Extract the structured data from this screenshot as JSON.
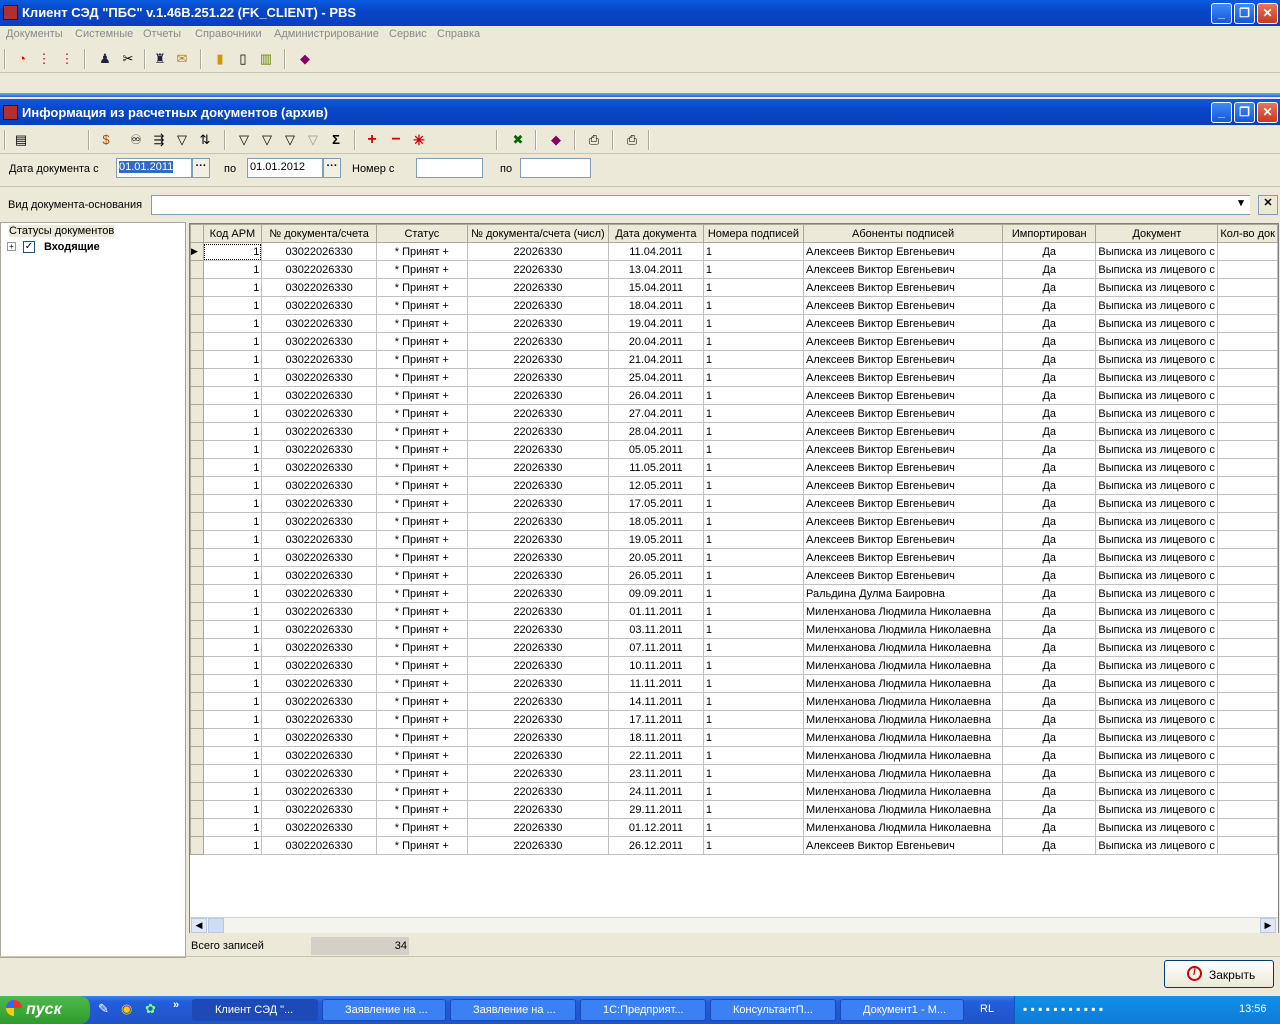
{
  "app": {
    "title": "Клиент СЭД \"ПБС\" v.1.46B.251.22 (FK_CLIENT) - PBS",
    "menu": [
      "Документы",
      "Системные",
      "Отчеты",
      "Справочники",
      "Администрирование",
      "Сервис",
      "Справка"
    ]
  },
  "child": {
    "title": "Информация из расчетных документов (архив)"
  },
  "filters": {
    "date_from_label": "Дата документа с",
    "date_from": "01.01.2011",
    "date_to_label": "по",
    "date_to": "01.01.2012",
    "num_from_label": "Номер с",
    "num_from": "",
    "num_to_label": "по",
    "num_to": "",
    "vid_label": "Вид документа-основания",
    "vid_value": ""
  },
  "left_panel": {
    "group_title": "Статусы документов",
    "tree_item": "Входящие"
  },
  "grid": {
    "columns": [
      "Код АРМ",
      "№ документа/счета",
      "Статус",
      "№ документа/счета (числ)",
      "Дата документа",
      "Номера подписей",
      "Абоненты подписей",
      "Импортирован",
      "Документ",
      "Кол-во док"
    ],
    "rows": [
      [
        "1",
        "03022026330",
        "* Принят +",
        "22026330",
        "11.04.2011",
        "1",
        "Алексеев Виктор Евгеньевич",
        "Да",
        "Выписка из лицевого с"
      ],
      [
        "1",
        "03022026330",
        "* Принят +",
        "22026330",
        "13.04.2011",
        "1",
        "Алексеев Виктор Евгеньевич",
        "Да",
        "Выписка из лицевого с"
      ],
      [
        "1",
        "03022026330",
        "* Принят +",
        "22026330",
        "15.04.2011",
        "1",
        "Алексеев Виктор Евгеньевич",
        "Да",
        "Выписка из лицевого с"
      ],
      [
        "1",
        "03022026330",
        "* Принят +",
        "22026330",
        "18.04.2011",
        "1",
        "Алексеев Виктор Евгеньевич",
        "Да",
        "Выписка из лицевого с"
      ],
      [
        "1",
        "03022026330",
        "* Принят +",
        "22026330",
        "19.04.2011",
        "1",
        "Алексеев Виктор Евгеньевич",
        "Да",
        "Выписка из лицевого с"
      ],
      [
        "1",
        "03022026330",
        "* Принят +",
        "22026330",
        "20.04.2011",
        "1",
        "Алексеев Виктор Евгеньевич",
        "Да",
        "Выписка из лицевого с"
      ],
      [
        "1",
        "03022026330",
        "* Принят +",
        "22026330",
        "21.04.2011",
        "1",
        "Алексеев Виктор Евгеньевич",
        "Да",
        "Выписка из лицевого с"
      ],
      [
        "1",
        "03022026330",
        "* Принят +",
        "22026330",
        "25.04.2011",
        "1",
        "Алексеев Виктор Евгеньевич",
        "Да",
        "Выписка из лицевого с"
      ],
      [
        "1",
        "03022026330",
        "* Принят +",
        "22026330",
        "26.04.2011",
        "1",
        "Алексеев Виктор Евгеньевич",
        "Да",
        "Выписка из лицевого с"
      ],
      [
        "1",
        "03022026330",
        "* Принят +",
        "22026330",
        "27.04.2011",
        "1",
        "Алексеев Виктор Евгеньевич",
        "Да",
        "Выписка из лицевого с"
      ],
      [
        "1",
        "03022026330",
        "* Принят +",
        "22026330",
        "28.04.2011",
        "1",
        "Алексеев Виктор Евгеньевич",
        "Да",
        "Выписка из лицевого с"
      ],
      [
        "1",
        "03022026330",
        "* Принят +",
        "22026330",
        "05.05.2011",
        "1",
        "Алексеев Виктор Евгеньевич",
        "Да",
        "Выписка из лицевого с"
      ],
      [
        "1",
        "03022026330",
        "* Принят +",
        "22026330",
        "11.05.2011",
        "1",
        "Алексеев Виктор Евгеньевич",
        "Да",
        "Выписка из лицевого с"
      ],
      [
        "1",
        "03022026330",
        "* Принят +",
        "22026330",
        "12.05.2011",
        "1",
        "Алексеев Виктор Евгеньевич",
        "Да",
        "Выписка из лицевого с"
      ],
      [
        "1",
        "03022026330",
        "* Принят +",
        "22026330",
        "17.05.2011",
        "1",
        "Алексеев Виктор Евгеньевич",
        "Да",
        "Выписка из лицевого с"
      ],
      [
        "1",
        "03022026330",
        "* Принят +",
        "22026330",
        "18.05.2011",
        "1",
        "Алексеев Виктор Евгеньевич",
        "Да",
        "Выписка из лицевого с"
      ],
      [
        "1",
        "03022026330",
        "* Принят +",
        "22026330",
        "19.05.2011",
        "1",
        "Алексеев Виктор Евгеньевич",
        "Да",
        "Выписка из лицевого с"
      ],
      [
        "1",
        "03022026330",
        "* Принят +",
        "22026330",
        "20.05.2011",
        "1",
        "Алексеев Виктор Евгеньевич",
        "Да",
        "Выписка из лицевого с"
      ],
      [
        "1",
        "03022026330",
        "* Принят +",
        "22026330",
        "26.05.2011",
        "1",
        "Алексеев Виктор Евгеньевич",
        "Да",
        "Выписка из лицевого с"
      ],
      [
        "1",
        "03022026330",
        "* Принят +",
        "22026330",
        "09.09.2011",
        "1",
        "Ральдина Дулма Баировна",
        "Да",
        "Выписка из лицевого с"
      ],
      [
        "1",
        "03022026330",
        "* Принят +",
        "22026330",
        "01.11.2011",
        "1",
        "Миленханова Людмила Николаевна",
        "Да",
        "Выписка из лицевого с"
      ],
      [
        "1",
        "03022026330",
        "* Принят +",
        "22026330",
        "03.11.2011",
        "1",
        "Миленханова Людмила Николаевна",
        "Да",
        "Выписка из лицевого с"
      ],
      [
        "1",
        "03022026330",
        "* Принят +",
        "22026330",
        "07.11.2011",
        "1",
        "Миленханова Людмила Николаевна",
        "Да",
        "Выписка из лицевого с"
      ],
      [
        "1",
        "03022026330",
        "* Принят +",
        "22026330",
        "10.11.2011",
        "1",
        "Миленханова Людмила Николаевна",
        "Да",
        "Выписка из лицевого с"
      ],
      [
        "1",
        "03022026330",
        "* Принят +",
        "22026330",
        "11.11.2011",
        "1",
        "Миленханова Людмила Николаевна",
        "Да",
        "Выписка из лицевого с"
      ],
      [
        "1",
        "03022026330",
        "* Принят +",
        "22026330",
        "14.11.2011",
        "1",
        "Миленханова Людмила Николаевна",
        "Да",
        "Выписка из лицевого с"
      ],
      [
        "1",
        "03022026330",
        "* Принят +",
        "22026330",
        "17.11.2011",
        "1",
        "Миленханова Людмила Николаевна",
        "Да",
        "Выписка из лицевого с"
      ],
      [
        "1",
        "03022026330",
        "* Принят +",
        "22026330",
        "18.11.2011",
        "1",
        "Миленханова Людмила Николаевна",
        "Да",
        "Выписка из лицевого с"
      ],
      [
        "1",
        "03022026330",
        "* Принят +",
        "22026330",
        "22.11.2011",
        "1",
        "Миленханова Людмила Николаевна",
        "Да",
        "Выписка из лицевого с"
      ],
      [
        "1",
        "03022026330",
        "* Принят +",
        "22026330",
        "23.11.2011",
        "1",
        "Миленханова Людмила Николаевна",
        "Да",
        "Выписка из лицевого с"
      ],
      [
        "1",
        "03022026330",
        "* Принят +",
        "22026330",
        "24.11.2011",
        "1",
        "Миленханова Людмила Николаевна",
        "Да",
        "Выписка из лицевого с"
      ],
      [
        "1",
        "03022026330",
        "* Принят +",
        "22026330",
        "29.11.2011",
        "1",
        "Миленханова Людмила Николаевна",
        "Да",
        "Выписка из лицевого с"
      ],
      [
        "1",
        "03022026330",
        "* Принят +",
        "22026330",
        "01.12.2011",
        "1",
        "Миленханова Людмила Николаевна",
        "Да",
        "Выписка из лицевого с"
      ],
      [
        "1",
        "03022026330",
        "* Принят +",
        "22026330",
        "26.12.2011",
        "1",
        "Алексеев Виктор Евгеньевич",
        "Да",
        "Выписка из лицевого с"
      ]
    ]
  },
  "status": {
    "total_label": "Всего записей",
    "total_value": "34"
  },
  "close_button": {
    "label": "Закрыть"
  },
  "taskbar": {
    "start": "пуск",
    "tasks": [
      "Клиент СЭД \"...",
      "Заявление на ...",
      "Заявление на ...",
      "1С:Предприят...",
      "КонсультантП...",
      "Документ1 - М..."
    ],
    "lang": "RL",
    "clock": "13:56"
  },
  "colors": {
    "titlebar": "#0a5be0",
    "face": "#ece9d8",
    "taskbar": "#245edb",
    "start": "#3a9e34"
  }
}
